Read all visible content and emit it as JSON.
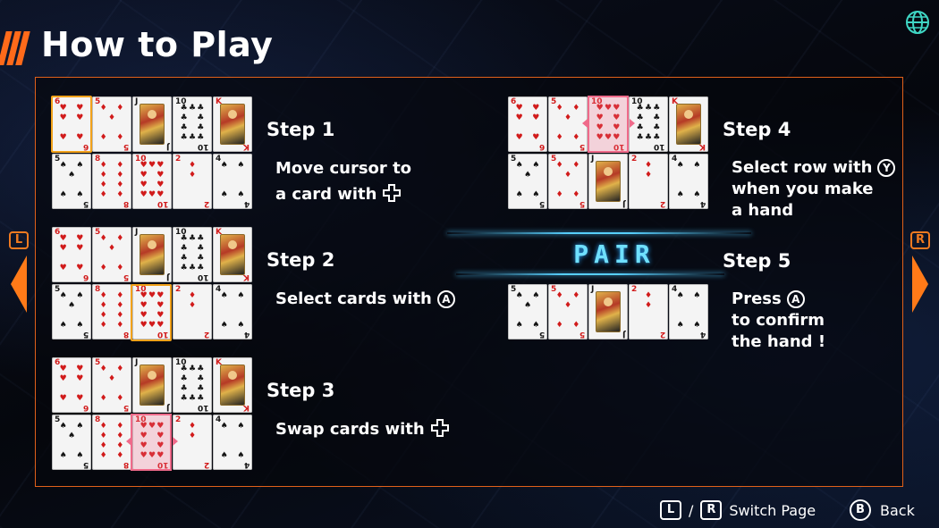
{
  "header": {
    "title": "How to Play",
    "globe_icon": "globe-icon"
  },
  "steps": [
    {
      "title": "Step 1",
      "lines": [
        "Move cursor to",
        "a card with"
      ],
      "icon": "dpad-icon"
    },
    {
      "title": "Step 2",
      "lines": [
        "Select cards with"
      ],
      "button": "A"
    },
    {
      "title": "Step 3",
      "lines": [
        "Swap cards with"
      ],
      "icon": "dpad-icon"
    },
    {
      "title": "Step 4",
      "lines": [
        "Select row with",
        "when you make",
        "a hand"
      ],
      "button": "Y"
    },
    {
      "title": "Step 5",
      "lines": [
        "Press",
        "to confirm",
        "the hand !"
      ],
      "button": "A"
    }
  ],
  "pair_label": "PAIR",
  "nav": {
    "left_key": "L",
    "right_key": "R"
  },
  "footer": {
    "l_key": "L",
    "separator": "/",
    "r_key": "R",
    "switch_label": "Switch Page",
    "b_key": "B",
    "back_label": "Back"
  },
  "colors": {
    "accent": "#ff6a1a",
    "cursor": "#f2a21a",
    "swap": "#ef6a8a",
    "pair": "#6fe0ff"
  },
  "cards": {
    "step1": [
      [
        "6♥",
        "5♦",
        "J♠",
        "10♣",
        "K♦"
      ],
      [
        "5♠",
        "8♦",
        "10♥",
        "2♦",
        "4♠"
      ]
    ],
    "step2": [
      [
        "6♥",
        "5♦",
        "J♠",
        "10♣",
        "K♦"
      ],
      [
        "5♠",
        "8♦",
        "10♥",
        "2♦",
        "4♠"
      ]
    ],
    "step3": [
      [
        "6♥",
        "5♦",
        "J♠",
        "10♣",
        "K♦"
      ],
      [
        "5♠",
        "8♦",
        "10♥",
        "2♦",
        "4♠"
      ]
    ],
    "step4": [
      [
        "6♥",
        "5♦",
        "10♥",
        "10♣",
        "K♦"
      ],
      [
        "5♠",
        "5♦",
        "J♠",
        "2♦",
        "4♠"
      ]
    ],
    "step5": [
      [
        "5♠",
        "5♦",
        "J♠",
        "2♦",
        "4♠"
      ]
    ]
  }
}
